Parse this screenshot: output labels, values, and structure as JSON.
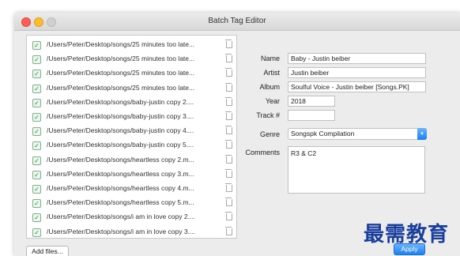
{
  "window": {
    "title": "Batch Tag Editor"
  },
  "files": [
    {
      "checked": true,
      "path": "/Users/Peter/Desktop/songs/25 minutes too late..."
    },
    {
      "checked": true,
      "path": "/Users/Peter/Desktop/songs/25 minutes too late..."
    },
    {
      "checked": true,
      "path": "/Users/Peter/Desktop/songs/25 minutes too late..."
    },
    {
      "checked": true,
      "path": "/Users/Peter/Desktop/songs/25 minutes too late..."
    },
    {
      "checked": true,
      "path": "/Users/Peter/Desktop/songs/baby-justin copy 2...."
    },
    {
      "checked": true,
      "path": "/Users/Peter/Desktop/songs/baby-justin copy 3...."
    },
    {
      "checked": true,
      "path": "/Users/Peter/Desktop/songs/baby-justin copy 4...."
    },
    {
      "checked": true,
      "path": "/Users/Peter/Desktop/songs/baby-justin copy 5...."
    },
    {
      "checked": true,
      "path": "/Users/Peter/Desktop/songs/heartless copy 2.m..."
    },
    {
      "checked": true,
      "path": "/Users/Peter/Desktop/songs/heartless copy 3.m..."
    },
    {
      "checked": true,
      "path": "/Users/Peter/Desktop/songs/heartless copy 4.m..."
    },
    {
      "checked": true,
      "path": "/Users/Peter/Desktop/songs/heartless copy 5.m..."
    },
    {
      "checked": true,
      "path": "/Users/Peter/Desktop/songs/i am in love copy 2...."
    },
    {
      "checked": true,
      "path": "/Users/Peter/Desktop/songs/i am in love copy 3...."
    }
  ],
  "form": {
    "name_label": "Name",
    "name_value": "Baby - Justin beiber",
    "artist_label": "Artist",
    "artist_value": "Justin beiber",
    "album_label": "Album",
    "album_value": "Soulful Voice - Justin beiber [Songs.PK]",
    "year_label": "Year",
    "year_value": "2018",
    "track_label": "Track #",
    "track_value": "",
    "genre_label": "Genre",
    "genre_value": "Songspk Compilation",
    "comments_label": "Comments",
    "comments_value": "R3 & C2"
  },
  "buttons": {
    "add_files": "Add files...",
    "apply": "Apply"
  },
  "watermark": "最需教育",
  "colors": {
    "accent": "#1b7ff5",
    "checkbox": "#2e8a45",
    "watermark": "#1a3e9e"
  },
  "icons": {
    "checkbox": "checkmark-icon",
    "delete": "trash-icon",
    "dropdown": "chevron-down-icon"
  }
}
